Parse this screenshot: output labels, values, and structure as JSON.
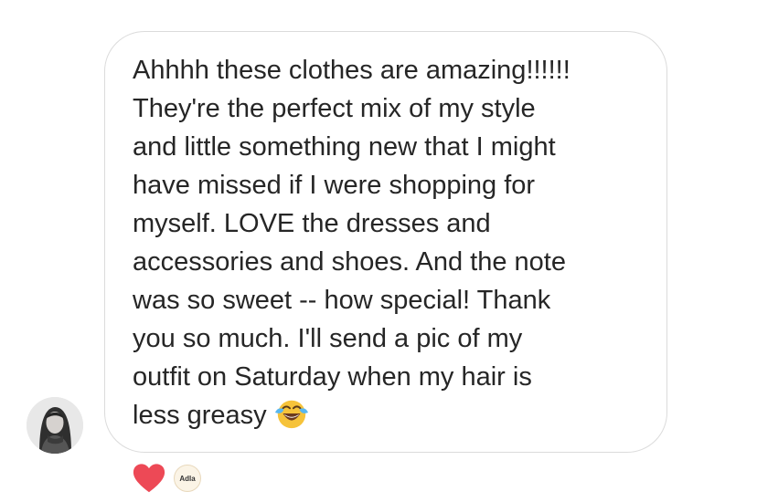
{
  "message": {
    "lines": [
      "Ahhhh these clothes are amazing!!!!!!",
      "They're the perfect mix of my style",
      "and little something new that I might",
      "have missed if I were shopping for",
      "myself. LOVE the dresses and",
      "accessories and shoes. And the note",
      "was so sweet -- how special! Thank",
      "you so much. I'll send a pic of my",
      "outfit on Saturday when my hair is",
      "less greasy"
    ],
    "trailing_emoji": "face-with-tears-of-joy-icon"
  },
  "reactions": {
    "reaction_icon": "heart-icon",
    "reaction_color": "#ed4956",
    "reactor_label": "Adla"
  },
  "colors": {
    "text": "#262626",
    "bubble_border": "#dbdbdb",
    "background": "#ffffff"
  }
}
